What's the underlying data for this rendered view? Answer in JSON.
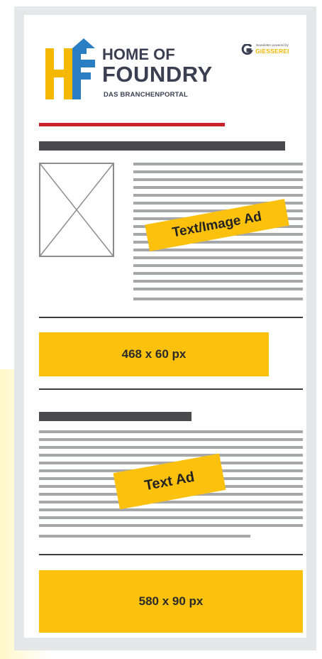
{
  "logo": {
    "line1": "HOME OF",
    "line2": "FOUNDRY",
    "tagline": "DAS BRANCHENPORTAL",
    "mark_icon": "hf-logo-icon"
  },
  "newsletter": {
    "powered_by": "Newsletter powered by",
    "brand": "GIESSEREI",
    "icon": "giesserei-g-icon"
  },
  "ads": {
    "text_image_label": "Text/Image Ad",
    "banner_small_label": "468 x 60 px",
    "text_ad_label": "Text Ad",
    "banner_large_label": "580 x 90 px"
  },
  "colors": {
    "accent_yellow": "#fbc10d",
    "accent_red": "#c8232b",
    "dark_text": "#3a3f52",
    "logo_blue": "#2a7fc4",
    "logo_yellow": "#f5b800"
  }
}
